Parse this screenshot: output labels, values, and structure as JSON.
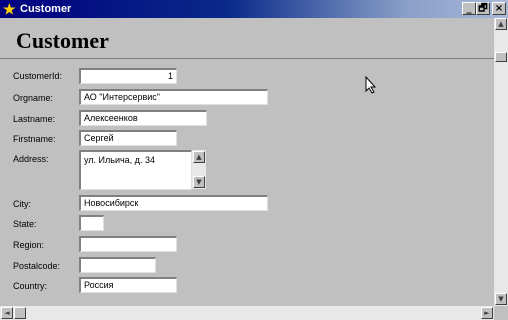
{
  "window": {
    "title": "Customer",
    "minimize": "_",
    "maximize": "🗗",
    "close": "×"
  },
  "form": {
    "title": "Customer",
    "fields": [
      {
        "label": "CustomerId:",
        "value": "1"
      },
      {
        "label": "Orgname:",
        "value": "АО \"Интерсервис\""
      },
      {
        "label": "Lastname:",
        "value": "Алексеенков"
      },
      {
        "label": "Firstname:",
        "value": "Сергей"
      },
      {
        "label": "Address:",
        "value": "ул. Ильича, д. 34"
      },
      {
        "label": "City:",
        "value": "Новосибирск"
      },
      {
        "label": "State:",
        "value": ""
      },
      {
        "label": "Region:",
        "value": ""
      },
      {
        "label": "Postalcode:",
        "value": ""
      },
      {
        "label": "Country:",
        "value": "Россия"
      }
    ]
  },
  "scroll": {
    "up": "▲",
    "down": "▼",
    "left": "◄",
    "right": "►"
  }
}
